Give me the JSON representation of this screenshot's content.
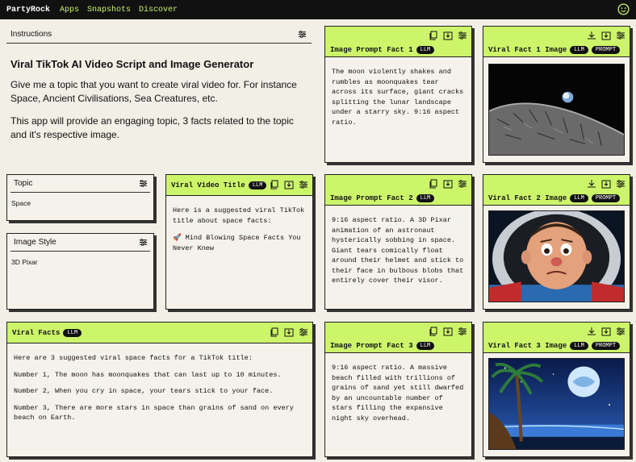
{
  "topbar": {
    "brand": "PartyRock",
    "nav": [
      "Apps",
      "Snapshots",
      "Discover"
    ]
  },
  "instructions": {
    "label": "Instructions",
    "title": "Viral TikTok AI Video Script and Image Generator",
    "p1": "Give me a topic that you want to create viral video for. For instance Space, Ancient Civilisations, Sea Creatures, etc.",
    "p2": "This app will provide an engaging topic, 3 facts related to the topic and it's respective image."
  },
  "topic": {
    "label": "Topic",
    "value": "Space"
  },
  "image_style": {
    "label": "Image Style",
    "value": "3D Pixar"
  },
  "viral_video_title": {
    "label": "Viral Video Title",
    "badge": "LLM",
    "line1": "Here is a suggested viral TikTok title about space facts:",
    "line2": "🚀 Mind Blowing Space Facts You Never Knew"
  },
  "viral_facts": {
    "label": "Viral Facts",
    "badge": "LLM",
    "lines": [
      "Here are 3 suggested viral space facts for a TikTok title:",
      "Number 1, The moon has moonquakes that can last up to 10 minutes.",
      "Number 2, When you cry in space, your tears stick to your face.",
      "Number 3, There are more stars in space than grains of sand on every beach on Earth."
    ]
  },
  "prompt_facts": [
    {
      "label": "Image Prompt Fact 1",
      "badge": "LLM",
      "text": "The moon violently shakes and rumbles as moonquakes tear across its surface, giant cracks splitting the lunar landscape under a starry sky. 9:16 aspect ratio."
    },
    {
      "label": "Image Prompt Fact 2",
      "badge": "LLM",
      "text": "9:16 aspect ratio. A 3D Pixar animation of an astronaut hysterically sobbing in space. Giant tears comically float around their helmet and stick to their face in bulbous blobs that entirely cover their visor."
    },
    {
      "label": "Image Prompt Fact 3",
      "badge": "LLM",
      "text": "9:16 aspect ratio. A massive beach filled with trillions of grains of sand yet still dwarfed by an uncountable number of stars filling the expansive night sky overhead."
    }
  ],
  "fact_images": [
    {
      "label": "Viral Fact 1 Image",
      "badge1": "LLM",
      "badge2": "PROMPT"
    },
    {
      "label": "Viral Fact 2 Image",
      "badge1": "LLM",
      "badge2": "PROMPT"
    },
    {
      "label": "Viral Fact 3 Image",
      "badge1": "LLM",
      "badge2": "PROMPT"
    }
  ],
  "colors": {
    "accent": "#cdf56a",
    "topbar": "#111111",
    "nav": "#c9f26b",
    "background": "#f1efe6"
  }
}
